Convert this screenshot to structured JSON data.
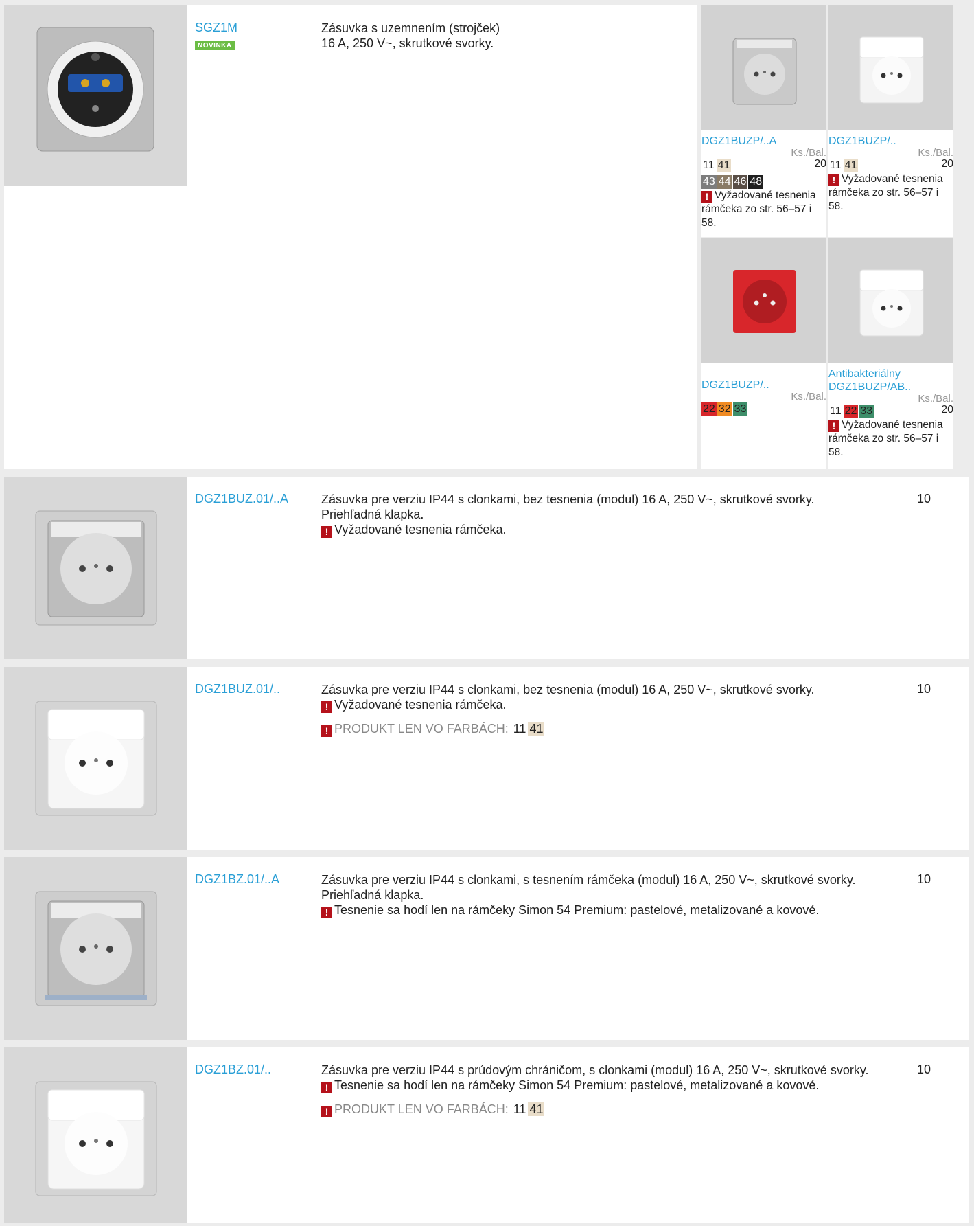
{
  "row1": {
    "code": "SGZ1M",
    "badge": "NOVINKA",
    "desc_line1": "Zásuvka s uzemnením (strojček)",
    "desc_line2": "16 A, 250 V~, skrutkové svorky.",
    "tiles": [
      {
        "code": "DGZ1BUZP/..A",
        "ks": "Ks./Bal.",
        "qty": "20",
        "colors_row1": [
          "11",
          "41"
        ],
        "colors_row2": [
          "43",
          "44",
          "46",
          "48"
        ],
        "note": "Vyžadované tesnenia rámčeka zo str. 56–57 i 58."
      },
      {
        "code": "DGZ1BUZP/..",
        "ks": "Ks./Bal.",
        "qty": "20",
        "colors_row1": [
          "11",
          "41"
        ],
        "note": "Vyžadované tesnenia rámčeka zo str. 56–57 i 58."
      },
      {
        "code": "DGZ1BUZP/..",
        "ks": "Ks./Bal.",
        "colors_row1": [
          "22",
          "32",
          "33"
        ]
      },
      {
        "code_line1": "Antibakteriálny",
        "code": "DGZ1BUZP/AB..",
        "ks": "Ks./Bal.",
        "qty": "20",
        "colors_row1": [
          "11",
          "22",
          "33"
        ],
        "note": "Vyžadované tesnenia rámčeka zo str. 56–57 i 58."
      }
    ]
  },
  "row2": {
    "code": "DGZ1BUZ.01/..A",
    "desc_line1": "Zásuvka pre verziu IP44 s clonkami, bez tesnenia (modul) 16 A, 250 V~, skrutkové svorky.",
    "desc_line2": "Priehľadná klapka.",
    "warn": "Vyžadované tesnenia rámčeka.",
    "qty": "10"
  },
  "row3": {
    "code": "DGZ1BUZ.01/..",
    "desc_line1": "Zásuvka pre verziu IP44 s clonkami, bez tesnenia (modul) 16 A, 250 V~, skrutkové svorky.",
    "warn": "Vyžadované tesnenia rámčeka.",
    "only_label": "PRODUKT LEN VO FARBÁCH:",
    "colors": [
      "11",
      "41"
    ],
    "qty": "10"
  },
  "row4": {
    "code": "DGZ1BZ.01/..A",
    "desc_line1": "Zásuvka pre verziu IP44 s clonkami, s tesnením rámčeka (modul) 16 A, 250 V~, skrutkové svorky.",
    "desc_line2": "Priehľadná klapka.",
    "warn": "Tesnenie sa hodí len na rámčeky Simon 54 Premium: pastelové, metalizované a kovové.",
    "qty": "10"
  },
  "row5": {
    "code": "DGZ1BZ.01/..",
    "desc_line1": "Zásuvka pre verziu IP44 s prúdovým chráničom, s clonkami (modul) 16 A, 250 V~, skrutkové svorky.",
    "warn": "Tesnenie sa hodí len na rámčeky Simon 54 Premium: pastelové, metalizované a kovové.",
    "only_label": "PRODUKT LEN VO FARBÁCH:",
    "colors": [
      "11",
      "41"
    ],
    "qty": "10"
  },
  "swatch_colors": {
    "11": "#ffffff",
    "41": "#e9ddc9",
    "43": "#7d7d7d",
    "44": "#8a7b66",
    "46": "#5a4f47",
    "48": "#1f1f1f",
    "22": "#d7262a",
    "32": "#f08b23",
    "33": "#3e8e6a"
  },
  "icons": [
    "warning-icon"
  ]
}
